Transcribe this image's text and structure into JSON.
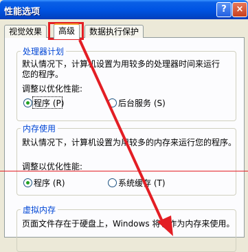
{
  "window": {
    "title": "性能选项",
    "help_label": "?",
    "close_label": "×"
  },
  "tabs": [
    {
      "label": "视觉效果"
    },
    {
      "label": "高级"
    },
    {
      "label": "数据执行保护"
    }
  ],
  "processor": {
    "legend": "处理器计划",
    "desc_line1": "默认情况下，计算机设置为用较多的处理器时间来运行",
    "desc_line2": "您的程序。",
    "adjust_label": "调整以优化性能:",
    "option_programs": "程序 (P)",
    "option_background": "后台服务 (S)"
  },
  "memory": {
    "legend": "内存使用",
    "desc_line1": "默认情况下，计算机设置为用较多的内存来运行您的程序。",
    "adjust_label": "调整以优化性能:",
    "option_programs": "程序 (R)",
    "option_cache": "系统缓存 (T)"
  },
  "virtual_memory": {
    "legend": "虚拟内存",
    "desc_line1": "页面文件存在于硬盘上，Windows 将它作为内存来使用。"
  },
  "colors": {
    "annotation_red": "#E31E24",
    "title_blue": "#0054E3",
    "legend_blue": "#0046D5"
  }
}
